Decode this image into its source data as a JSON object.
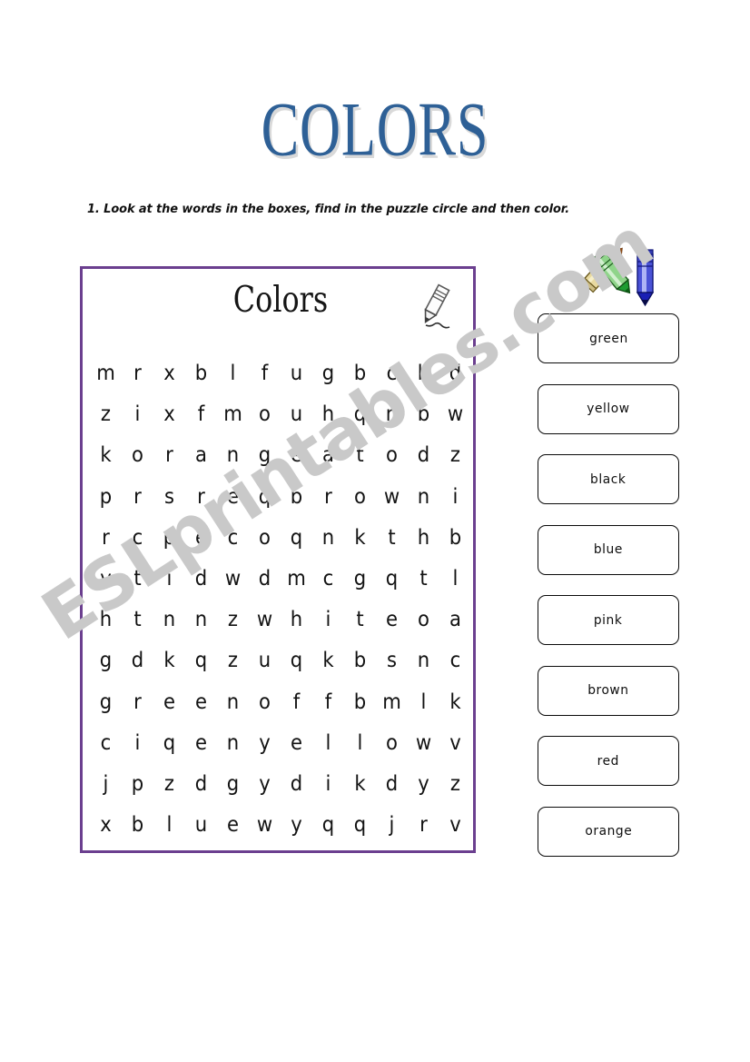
{
  "page": {
    "title": "COLORS",
    "title_color": "#2e6096",
    "background": "#ffffff",
    "watermark": "ESLprintables.com",
    "watermark_color": "#c9c9c9"
  },
  "instruction": {
    "text": "1. Look at the words in the boxes, find in the puzzle circle and then color."
  },
  "puzzle": {
    "heading": "Colors",
    "border_color": "#6b3f8f",
    "pencil_icon": "pencil-doodle-icon",
    "grid_rows": 12,
    "grid_cols": 12,
    "grid": [
      [
        "m",
        "r",
        "x",
        "b",
        "l",
        "f",
        "u",
        "g",
        "b",
        "c",
        "b",
        "d"
      ],
      [
        "z",
        "i",
        "x",
        "f",
        "m",
        "o",
        "u",
        "h",
        "q",
        "n",
        "b",
        "w"
      ],
      [
        "k",
        "o",
        "r",
        "a",
        "n",
        "g",
        "e",
        "a",
        "t",
        "o",
        "d",
        "z"
      ],
      [
        "p",
        "r",
        "s",
        "r",
        "e",
        "q",
        "b",
        "r",
        "o",
        "w",
        "n",
        "i"
      ],
      [
        "r",
        "c",
        "p",
        "e",
        "c",
        "o",
        "q",
        "n",
        "k",
        "t",
        "h",
        "b"
      ],
      [
        "v",
        "t",
        "i",
        "d",
        "w",
        "d",
        "m",
        "c",
        "g",
        "q",
        "t",
        "l"
      ],
      [
        "h",
        "t",
        "n",
        "n",
        "z",
        "w",
        "h",
        "i",
        "t",
        "e",
        "o",
        "a"
      ],
      [
        "g",
        "d",
        "k",
        "q",
        "z",
        "u",
        "q",
        "k",
        "b",
        "s",
        "n",
        "c"
      ],
      [
        "g",
        "r",
        "e",
        "e",
        "n",
        "o",
        "f",
        "f",
        "b",
        "m",
        "l",
        "k"
      ],
      [
        "c",
        "i",
        "q",
        "e",
        "n",
        "y",
        "e",
        "l",
        "l",
        "o",
        "w",
        "v"
      ],
      [
        "j",
        "p",
        "z",
        "d",
        "g",
        "y",
        "d",
        "i",
        "k",
        "d",
        "y",
        "z"
      ],
      [
        "x",
        "b",
        "l",
        "u",
        "e",
        "w",
        "y",
        "q",
        "q",
        "j",
        "r",
        "v"
      ]
    ]
  },
  "clipart": {
    "crayons_icon": "three-crayons-icon",
    "crayon_colors": [
      "#c87430",
      "#1e9b32",
      "#1a1fb4"
    ]
  },
  "word_list": {
    "items": [
      {
        "label": "green"
      },
      {
        "label": "yellow"
      },
      {
        "label": "black"
      },
      {
        "label": "blue"
      },
      {
        "label": "pink"
      },
      {
        "label": "brown"
      },
      {
        "label": "red"
      },
      {
        "label": "orange"
      }
    ]
  }
}
